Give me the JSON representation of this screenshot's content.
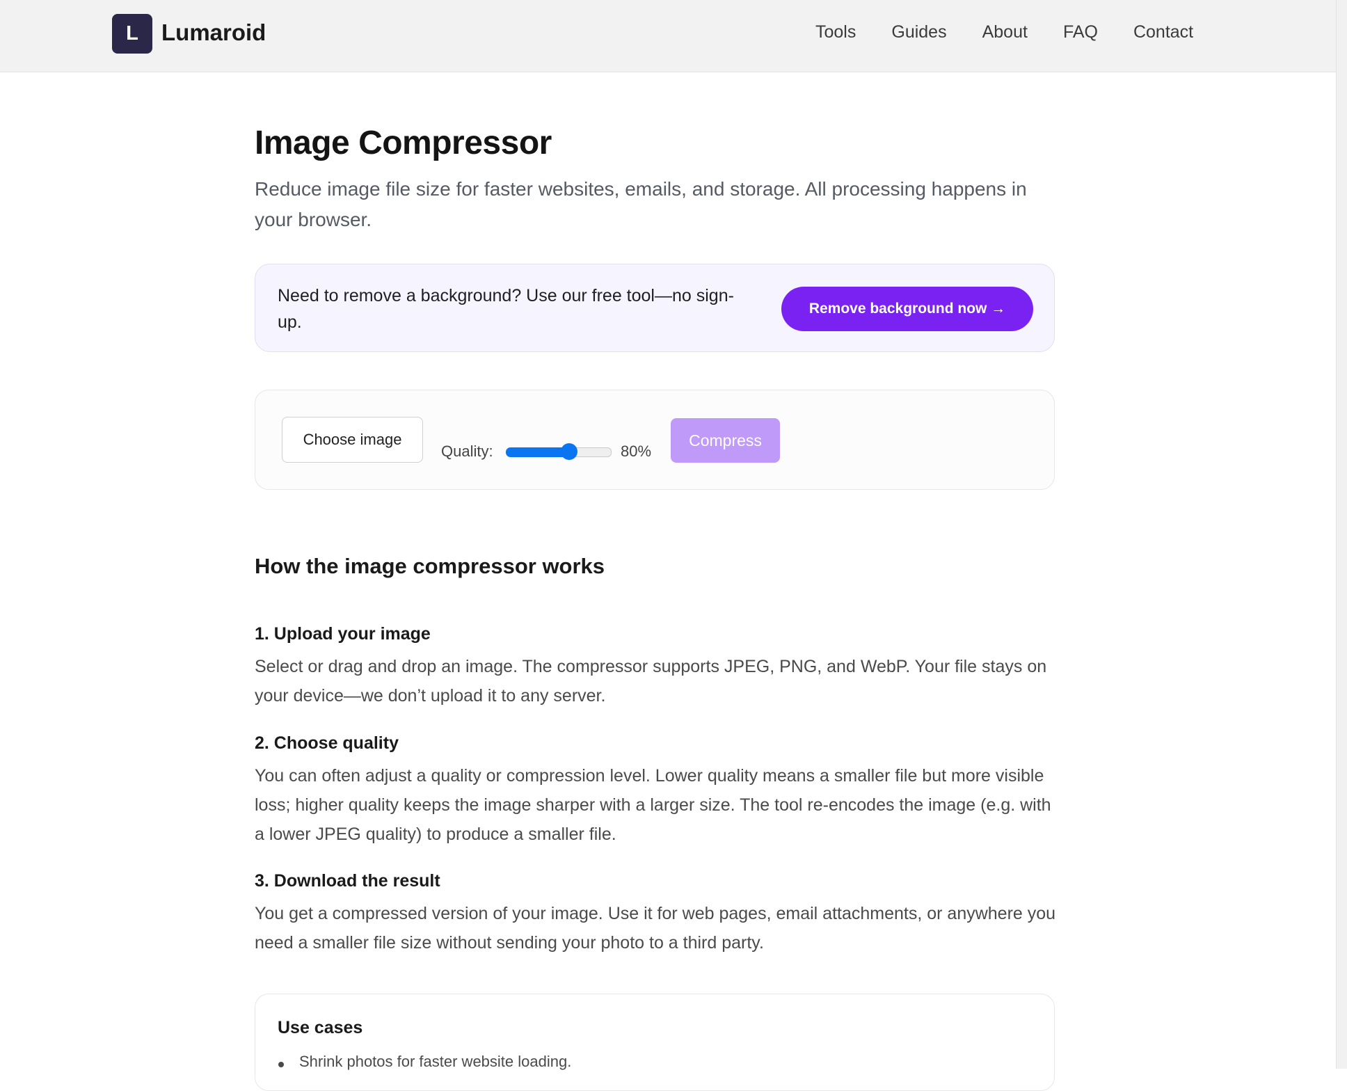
{
  "brand": {
    "logo_letter": "L",
    "name": "Lumaroid"
  },
  "nav": [
    "Tools",
    "Guides",
    "About",
    "FAQ",
    "Contact"
  ],
  "page": {
    "title": "Image Compressor",
    "subtitle": "Reduce image file size for faster websites, emails, and storage. All processing happens in your browser."
  },
  "promo": {
    "text": "Need to remove a background? Use our free tool—no sign-up.",
    "button": "Remove background now →"
  },
  "tool": {
    "choose_label": "Choose image",
    "quality_label": "Quality:",
    "quality_value": "80%",
    "quality_fraction": 0.8,
    "compress_label": "Compress"
  },
  "how": {
    "heading": "How the image compressor works",
    "steps": [
      {
        "title": "1. Upload your image",
        "text": "Select or drag and drop an image. The compressor supports JPEG, PNG, and WebP. Your file stays on your device—we don’t upload it to any server."
      },
      {
        "title": "2. Choose quality",
        "text": "You can often adjust a quality or compression level. Lower quality means a smaller file but more visible loss; higher quality keeps the image sharper with a larger size. The tool re-encodes the image (e.g. with a lower JPEG quality) to produce a smaller file."
      },
      {
        "title": "3. Download the result",
        "text": "You get a compressed version of your image. Use it for web pages, email attachments, or anywhere you need a smaller file size without sending your photo to a third party."
      }
    ]
  },
  "usecases": {
    "title": "Use cases",
    "items": [
      "Shrink photos for faster website loading."
    ]
  },
  "colors": {
    "accent": "#7a22f2",
    "accent_disabled": "#c09af8",
    "slider": "#0a75f0",
    "logo_bg": "#2a2749"
  }
}
